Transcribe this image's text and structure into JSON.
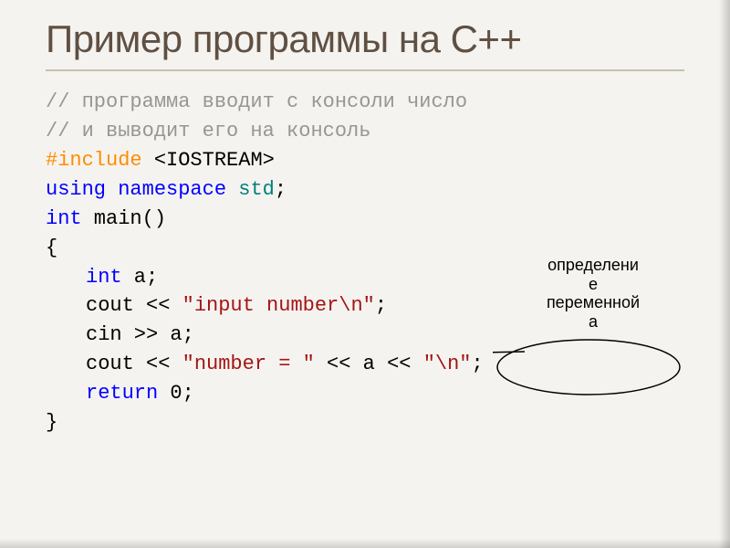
{
  "title": "Пример программы на С++",
  "code": {
    "comment1": "// программа вводит с консоли число",
    "comment2": "// и выводит его на консоль",
    "include_kw": "#include",
    "include_hdr": " <IOSTREAM>",
    "using_kw": "using",
    "namespace_kw": " namespace ",
    "std_id": "std",
    "semi": ";",
    "int_kw": "int",
    "main_id": " main()",
    "brace_open": "{",
    "decl_int": "int",
    "decl_rest": " a;",
    "cout1_a": "cout << ",
    "cout1_str": "\"input number\\n\"",
    "cout1_end": ";",
    "cin_line": "cin >> a;",
    "cout2_a": "cout << ",
    "cout2_str1": "\"number = \"",
    "cout2_mid": " << a << ",
    "cout2_str2": "\"\\n\"",
    "cout2_end": ";",
    "return_kw": "return",
    "return_rest": " 0;",
    "brace_close": "}"
  },
  "callout": {
    "line1": "определени",
    "line2": "е",
    "line3": "переменной",
    "line4": "а"
  }
}
